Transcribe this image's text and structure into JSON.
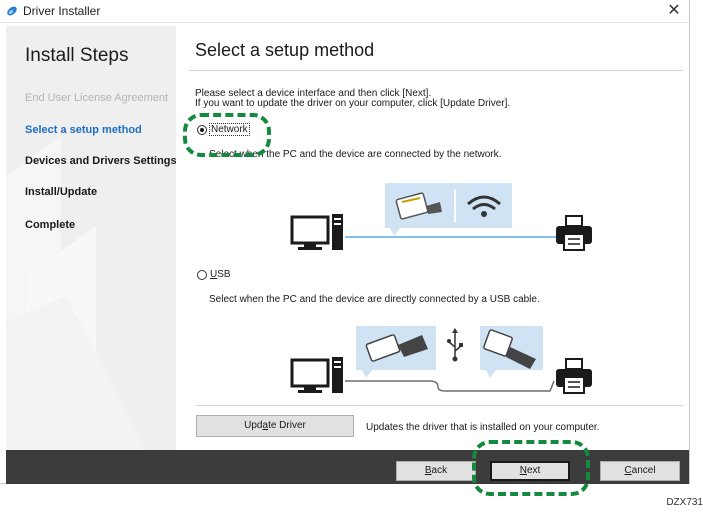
{
  "window": {
    "title": "Driver Installer",
    "close_glyph": "✕"
  },
  "sidebar": {
    "heading": "Install Steps",
    "steps": [
      {
        "label": "End User License Agreement",
        "state": "done"
      },
      {
        "label": "Select a setup method",
        "state": "active"
      },
      {
        "label": "Devices and Drivers Settings",
        "state": "pending"
      },
      {
        "label": "Install/Update",
        "state": "pending"
      },
      {
        "label": "Complete",
        "state": "pending"
      }
    ]
  },
  "main": {
    "title": "Select a setup method",
    "instruction_1": "Please select a device interface and then click [Next].",
    "instruction_2": "If you want to update the driver on your computer, click [Update Driver].",
    "network": {
      "label": "Network",
      "selected": true,
      "description": "Select when the PC and the device are connected by the network."
    },
    "usb": {
      "label_underlined": "U",
      "label_rest": "SB",
      "selected": false,
      "description": "Select when the PC and the device are directly connected by a USB cable."
    },
    "update_driver": {
      "label_pre": "Upd",
      "label_underlined": "a",
      "label_post": "te Driver",
      "description": "Updates the driver that is installed on your computer."
    }
  },
  "footer": {
    "back": {
      "underlined": "B",
      "rest": "ack"
    },
    "next": {
      "underlined": "N",
      "rest": "ext"
    },
    "cancel": {
      "underlined": "C",
      "rest": "ancel"
    }
  },
  "watermark": "DZX731",
  "colors": {
    "accent_blue": "#1e6fc4",
    "highlight_green": "#148a3f",
    "footer": "#3c3c3c",
    "illustration_blue": "#cfe3f4"
  },
  "icons": [
    "app-logo-icon",
    "close-icon",
    "computer-icon",
    "printer-icon",
    "ethernet-plug-icon",
    "wifi-icon",
    "usb-a-plug-icon",
    "usb-b-plug-icon",
    "usb-symbol-icon"
  ]
}
